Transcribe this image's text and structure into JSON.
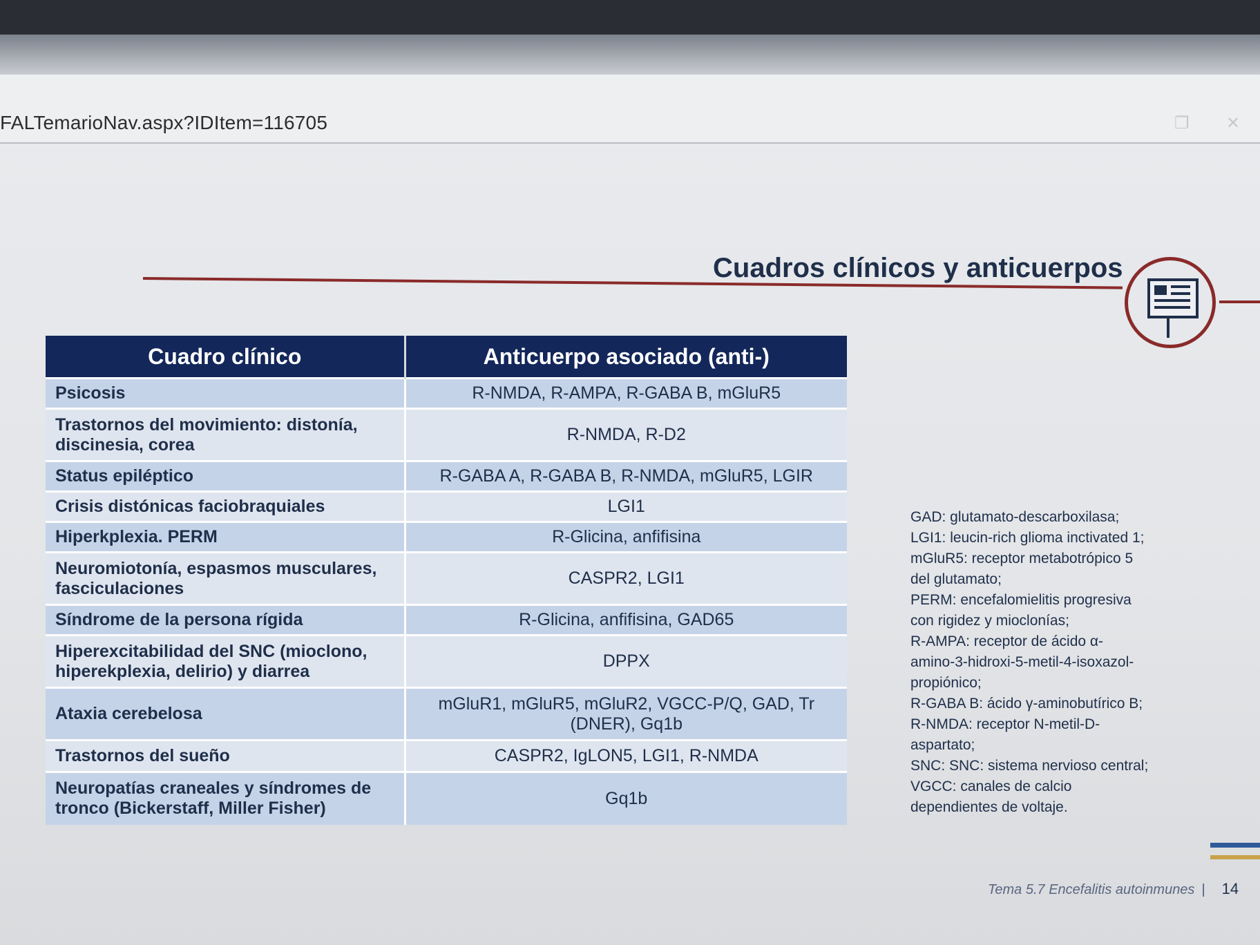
{
  "browser": {
    "url_fragment": "FALTemarioNav.aspx?IDItem=116705"
  },
  "slide": {
    "title": "Cuadros clínicos y anticuerpos",
    "table": {
      "headers": [
        "Cuadro clínico",
        "Anticuerpo asociado (anti-)"
      ],
      "rows": [
        {
          "cuadro": "Psicosis",
          "anticuerpo": "R-NMDA, R-AMPA, R-GABA B, mGluR5"
        },
        {
          "cuadro": "Trastornos del movimiento: distonía, discinesia, corea",
          "anticuerpo": "R-NMDA, R-D2"
        },
        {
          "cuadro": "Status epiléptico",
          "anticuerpo": "R-GABA A, R-GABA B, R-NMDA, mGluR5, LGIR"
        },
        {
          "cuadro": "Crisis distónicas faciobraquiales",
          "anticuerpo": "LGI1"
        },
        {
          "cuadro": "Hiperkplexia. PERM",
          "anticuerpo": "R-Glicina, anfifisina"
        },
        {
          "cuadro": "Neuromiotonía, espasmos musculares, fasciculaciones",
          "anticuerpo": "CASPR2, LGI1"
        },
        {
          "cuadro": "Síndrome de la persona rígida",
          "anticuerpo": "R-Glicina, anfifisina, GAD65"
        },
        {
          "cuadro": "Hiperexcitabilidad del SNC (mioclono, hiperekplexia, delirio) y diarrea",
          "anticuerpo": "DPPX"
        },
        {
          "cuadro": "Ataxia cerebelosa",
          "anticuerpo": "mGluR1, mGluR5, mGluR2, VGCC-P/Q, GAD, Tr (DNER), Gq1b"
        },
        {
          "cuadro": "Trastornos del sueño",
          "anticuerpo": "CASPR2, IgLON5, LGI1, R-NMDA"
        },
        {
          "cuadro": "Neuropatías craneales y síndromes de tronco (Bickerstaff, Miller Fisher)",
          "anticuerpo": "Gq1b"
        }
      ]
    },
    "glossary": [
      "GAD: glutamato-descarboxilasa;",
      "LGI1: leucin-rich glioma inctivated 1;",
      "mGluR5: receptor metabotrópico 5",
      "del glutamato;",
      "PERM: encefalomielitis progresiva",
      "con rigidez y mioclonías;",
      "R-AMPA: receptor de ácido α-",
      "amino-3-hidroxi-5-metil-4-isoxazol-",
      "propiónico;",
      "R-GABA B: ácido γ-aminobutírico B;",
      "R-NMDA: receptor N-metil-D-",
      "aspartato;",
      "SNC: SNC: sistema nervioso central;",
      "VGCC: canales de calcio",
      "dependientes de voltaje."
    ],
    "footer": {
      "topic": "Tema 5.7  Encefalitis autoinmunes",
      "separator": "|",
      "page": "14"
    }
  }
}
